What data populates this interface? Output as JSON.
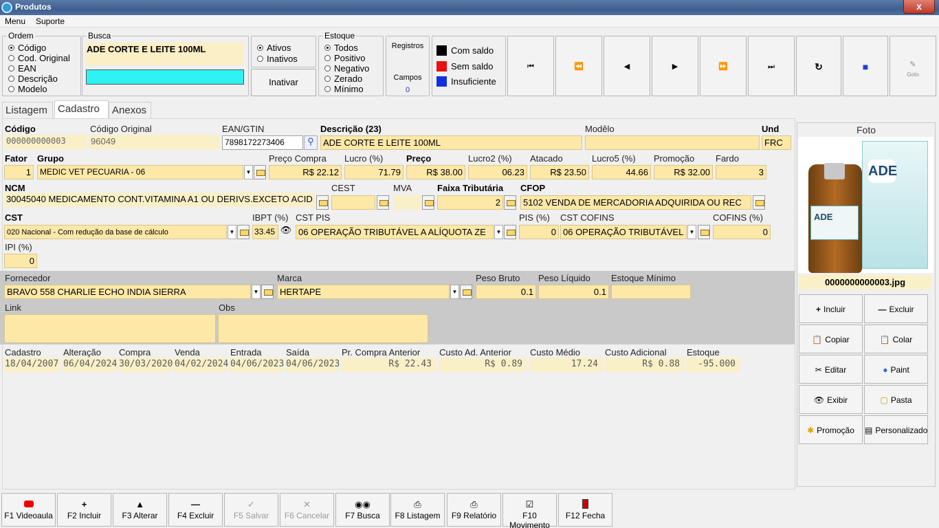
{
  "window": {
    "title": "Produtos",
    "close": "x"
  },
  "menu": {
    "items": [
      "Menu",
      "Suporte"
    ]
  },
  "ordem": {
    "legend": "Ordem",
    "options": [
      "Código",
      "Cod. Original",
      "EAN",
      "Descrição",
      "Modelo"
    ],
    "selected": "Código"
  },
  "busca": {
    "legend": "Busca",
    "text": "ADE CORTE E LEITE 100ML",
    "input_value": ""
  },
  "status": {
    "options": [
      "Ativos",
      "Inativos"
    ],
    "selected": "Ativos",
    "button": "Inativar"
  },
  "estoque": {
    "legend": "Estoque",
    "options": [
      "Todos",
      "Positivo",
      "Negativo",
      "Zerado",
      "Mínimo"
    ],
    "selected": "Todos"
  },
  "registros": {
    "label": "Registros",
    "campos_label": "Campos",
    "campos_value": "0"
  },
  "legend_colors": [
    {
      "label": "Com saldo",
      "color": "#000000"
    },
    {
      "label": "Sem saldo",
      "color": "#e81010"
    },
    {
      "label": "Insuficiente",
      "color": "#1030e0"
    }
  ],
  "nav": [
    "first-icon",
    "prev-page-icon",
    "prev-icon",
    "next-icon",
    "next-page-icon",
    "last-icon",
    "refresh-icon",
    "eraser-icon",
    "goto-icon"
  ],
  "nav_goto_label": "Goto",
  "tabs": [
    "Listagem",
    "Cadastro",
    "Anexos"
  ],
  "form": {
    "codigo": {
      "label": "Código",
      "value": "000000000003"
    },
    "codigo_original": {
      "label": "Código Original",
      "value": "96049"
    },
    "ean": {
      "label": "EAN/GTIN",
      "value": "7898172273406"
    },
    "descricao": {
      "label": "Descrição (23)",
      "value": "ADE CORTE E LEITE 100ML"
    },
    "modelo": {
      "label": "Modêlo",
      "value": ""
    },
    "und": {
      "label": "Und",
      "value": "FRC"
    },
    "fator": {
      "label": "Fator",
      "value": "1"
    },
    "grupo": {
      "label": "Grupo",
      "value": "MEDIC VET PECUARIA - 06"
    },
    "preco_compra": {
      "label": "Preço Compra",
      "value": "R$ 22.12"
    },
    "lucro": {
      "label": "Lucro (%)",
      "value": "71.79"
    },
    "preco": {
      "label": "Preço",
      "value": "R$ 38.00"
    },
    "lucro2": {
      "label": "Lucro2 (%)",
      "value": "06.23"
    },
    "atacado": {
      "label": "Atacado",
      "value": "R$ 23.50"
    },
    "lucro5": {
      "label": "Lucro5 (%)",
      "value": "44.66"
    },
    "promocao": {
      "label": "Promoção",
      "value": "R$ 32.00"
    },
    "fardo": {
      "label": "Fardo",
      "value": "3"
    },
    "ncm": {
      "label": "NCM",
      "value": "30045040 MEDICAMENTO CONT.VITAMINA A1 OU DERIVS.EXCETO ACID"
    },
    "cest": {
      "label": "CEST",
      "value": ""
    },
    "mva": {
      "label": "MVA",
      "value": ""
    },
    "faixa": {
      "label": "Faixa Tributária",
      "value": "2"
    },
    "cfop": {
      "label": "CFOP",
      "value": "5102 VENDA DE MERCADORIA ADQUIRIDA OU REC"
    },
    "cst": {
      "label": "CST",
      "value": "020 Nacional - Com redução da base de cálculo"
    },
    "ibpt": {
      "label": "IBPT (%)",
      "value": "33.45"
    },
    "cst_pis": {
      "label": "CST PIS",
      "value": "06 OPERAÇÃO TRIBUTÁVEL A ALÍQUOTA ZE"
    },
    "pis": {
      "label": "PIS (%)",
      "value": "0"
    },
    "cst_cofins": {
      "label": "CST COFINS",
      "value": "06 OPERAÇÃO TRIBUTÁVEL"
    },
    "cofins": {
      "label": "COFINS (%)",
      "value": "0"
    },
    "ipi": {
      "label": "IPI (%)",
      "value": "0"
    },
    "fornecedor": {
      "label": "Fornecedor",
      "value": "BRAVO 558 CHARLIE ECHO INDIA SIERRA"
    },
    "marca": {
      "label": "Marca",
      "value": "HERTAPE"
    },
    "peso_bruto": {
      "label": "Peso Bruto",
      "value": "0.1"
    },
    "peso_liquido": {
      "label": "Peso Líquido",
      "value": "0.1"
    },
    "estoque_minimo": {
      "label": "Estoque Mínimo",
      "value": ""
    },
    "link": {
      "label": "Link",
      "value": ""
    },
    "obs": {
      "label": "Obs",
      "value": ""
    }
  },
  "history": [
    {
      "label": "Cadastro",
      "value": "18/04/2007"
    },
    {
      "label": "Alteração",
      "value": "06/04/2024"
    },
    {
      "label": "Compra",
      "value": "30/03/2020"
    },
    {
      "label": "Venda",
      "value": "04/02/2024"
    },
    {
      "label": "Entrada",
      "value": "04/06/2023"
    },
    {
      "label": "Saída",
      "value": "04/06/2023"
    },
    {
      "label": "Pr. Compra Anterior",
      "value": "R$ 22.43"
    },
    {
      "label": "Custo Ad. Anterior",
      "value": "R$ 0.89"
    },
    {
      "label": "Custo Médio",
      "value": "17.24"
    },
    {
      "label": "Custo Adicional",
      "value": "R$ 0.88"
    },
    {
      "label": "Estoque",
      "value": "-95.000"
    }
  ],
  "foto": {
    "title": "Foto",
    "filename": "0000000000003.jpg",
    "product_text": "ADE"
  },
  "photo_buttons": [
    "Incluir",
    "Excluir",
    "Copiar",
    "Colar",
    "Editar",
    "Paint",
    "Exibir",
    "Pasta",
    "Promoção",
    "Personalizado"
  ],
  "footer": [
    {
      "label": "F1 Videoaula",
      "icon": "youtube-icon"
    },
    {
      "label": "F2 Incluir",
      "icon": "plus-icon"
    },
    {
      "label": "F3 Alterar",
      "icon": "up-arrow-icon"
    },
    {
      "label": "F4 Excluir",
      "icon": "minus-icon"
    },
    {
      "label": "F5 Salvar",
      "icon": "check-icon"
    },
    {
      "label": "F6 Cancelar",
      "icon": "x-icon"
    },
    {
      "label": "F7 Busca",
      "icon": "binoculars-icon"
    },
    {
      "label": "F8 Listagem",
      "icon": "printer-icon"
    },
    {
      "label": "F9 Relatório",
      "icon": "printer-icon"
    },
    {
      "label": "F10 Movimento",
      "icon": "document-check-icon"
    },
    {
      "label": "F12 Fecha",
      "icon": "exit-icon"
    }
  ]
}
